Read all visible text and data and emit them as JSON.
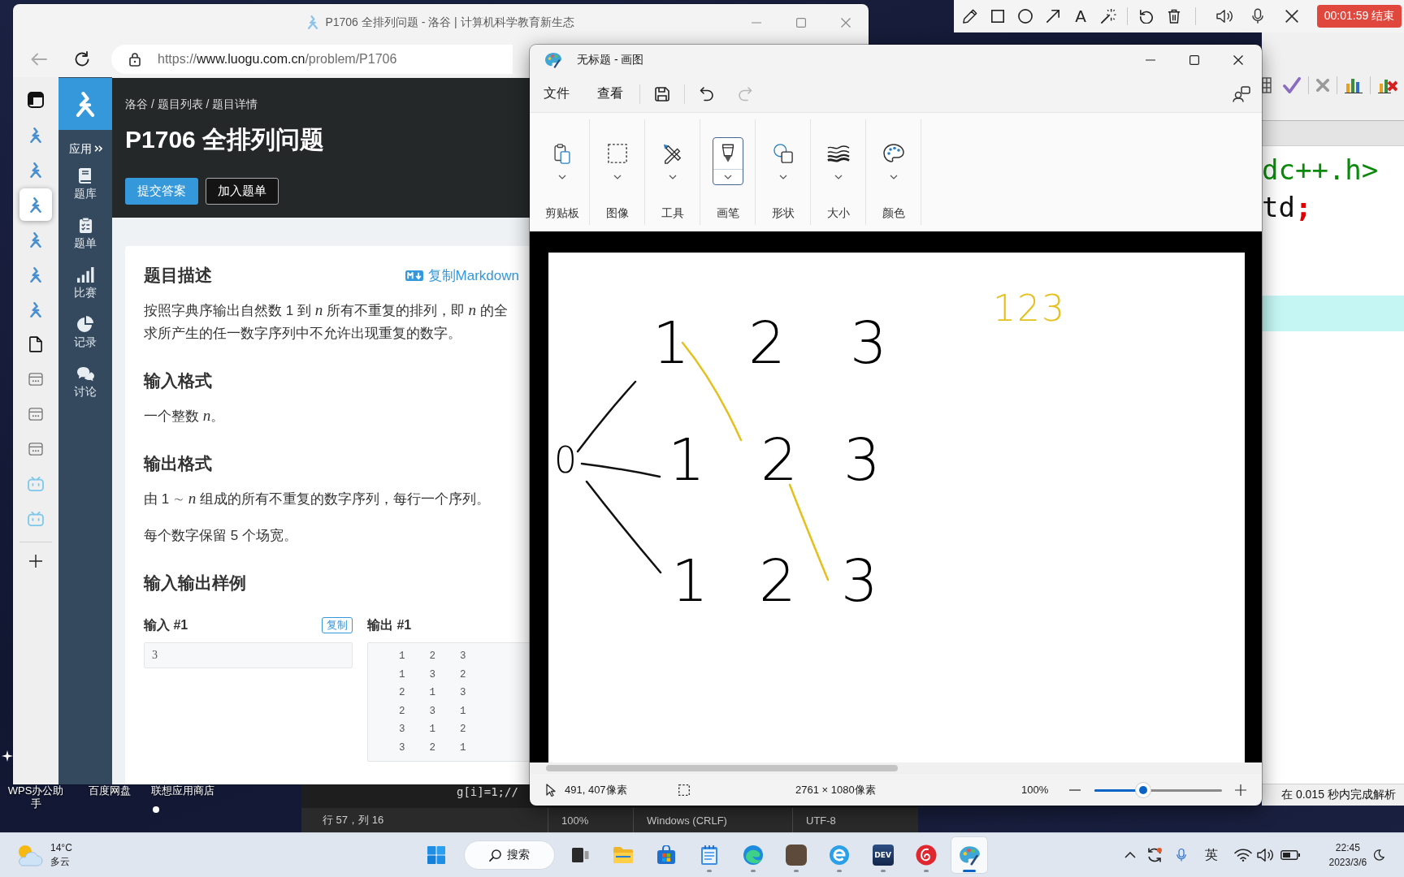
{
  "recorder": {
    "text_tool": "A",
    "timer_button": "00:01:59 结束"
  },
  "devcpp": {
    "code_lines": [
      {
        "tokens": [
          {
            "text": "dc++.h>",
            "kind": "preprocessor"
          }
        ]
      },
      {
        "tokens": [
          {
            "text": "td",
            "kind": "plain"
          },
          {
            "text": ";",
            "kind": "symbol"
          }
        ]
      }
    ],
    "status": "在 0.015 秒内完成解析"
  },
  "notepad": {
    "code_line": "g[i]=1;//",
    "status": [
      "行 57，列 16",
      "100%",
      "Windows (CRLF)",
      "UTF-8"
    ]
  },
  "desktop_icons": [
    "WPS办公助手",
    "百度网盘",
    "联想应用商店"
  ],
  "browser": {
    "title": "P1706 全排列问题 - 洛谷 | 计算机科学教育新生态",
    "url": "https://www.luogu.com.cn/problem/P1706",
    "tabs": [
      {
        "kind": "logo",
        "selected": false
      },
      {
        "kind": "logo",
        "selected": false
      },
      {
        "kind": "logo",
        "selected": true
      },
      {
        "kind": "logo",
        "selected": false
      },
      {
        "kind": "logo",
        "selected": false
      },
      {
        "kind": "logo",
        "selected": false
      },
      {
        "kind": "document",
        "selected": false
      },
      {
        "kind": "window",
        "selected": false
      },
      {
        "kind": "window",
        "selected": false
      },
      {
        "kind": "window",
        "selected": false
      },
      {
        "kind": "tv",
        "selected": false
      },
      {
        "kind": "tv",
        "selected": false
      }
    ],
    "site_nav": {
      "apps_label": "应用",
      "items": [
        {
          "label": "题库",
          "kind": "book"
        },
        {
          "label": "题单",
          "kind": "list"
        },
        {
          "label": "比赛",
          "kind": "bars"
        },
        {
          "label": "记录",
          "kind": "pie"
        },
        {
          "label": "讨论",
          "kind": "chat"
        }
      ]
    },
    "header": {
      "breadcrumb": "洛谷 / 题目列表 / 题目详情",
      "title": "P1706 全排列问题",
      "buttons": [
        {
          "label": "提交答案",
          "kind": "primary"
        },
        {
          "label": "加入题单",
          "kind": "secondary"
        }
      ]
    },
    "problem": {
      "sections": [
        {
          "heading": "题目描述",
          "link": "复制Markdown",
          "paragraphs": [
            [
              "按照字典序输出自然数 1 到 *n* 所有不重复的排列，即 *n* 的全",
              "求所产生的任一数字序列中不允许出现重复的数字。"
            ]
          ]
        },
        {
          "heading": "输入格式",
          "paragraphs": [
            [
              "一个整数 *n*。"
            ]
          ]
        },
        {
          "heading": "输出格式",
          "paragraphs": [
            [
              "由 1 ∼ *n* 组成的所有不重复的数字序列，每行一个序列。"
            ],
            [
              "每个数字保留 5 个场宽。"
            ]
          ]
        },
        {
          "heading": "输入输出样例"
        }
      ],
      "samples": {
        "input": {
          "label": "输入 #1",
          "copy": "复制",
          "value": "3"
        },
        "output": {
          "label": "输出 #1",
          "rows": [
            "1    2    3",
            "1    3    2",
            "2    1    3",
            "2    3    1",
            "3    1    2",
            "3    2    1"
          ]
        }
      }
    }
  },
  "paint": {
    "title": "无标题 - 画图",
    "menu": [
      "文件",
      "查看"
    ],
    "quick": [
      {
        "kind": "save",
        "disabled": false
      },
      {
        "kind": "undo",
        "disabled": false
      },
      {
        "kind": "redo",
        "disabled": true
      }
    ],
    "ribbon": [
      {
        "label": "剪贴板",
        "kind": "clipboard",
        "selected": false
      },
      {
        "label": "图像",
        "kind": "image",
        "selected": false
      },
      {
        "label": "工具",
        "kind": "tools",
        "selected": false
      },
      {
        "label": "画笔",
        "kind": "brushes",
        "selected": true
      },
      {
        "label": "形状",
        "kind": "shapes",
        "selected": false
      },
      {
        "label": "大小",
        "kind": "size",
        "selected": false
      },
      {
        "label": "颜色",
        "kind": "colors",
        "selected": false
      }
    ],
    "canvas": {
      "root": "0",
      "rows": [
        [
          "1",
          "2",
          "3"
        ],
        [
          "1",
          "2",
          "3"
        ],
        [
          "1",
          "2",
          "3"
        ]
      ],
      "note": "123"
    },
    "status": {
      "cursor": "491, 407像素",
      "image_size": "2761 × 1080像素",
      "zoom": "100%",
      "zoom_slider": {
        "level": 0.38
      }
    }
  },
  "taskbar": {
    "weather": {
      "temperature": "14°C",
      "condition": "多云"
    },
    "search_label": "搜索",
    "apps": [
      {
        "kind": "taskview",
        "running": false,
        "selected": false
      },
      {
        "kind": "explorer",
        "running": false,
        "selected": false
      },
      {
        "kind": "store",
        "running": false,
        "selected": false
      },
      {
        "kind": "notepad",
        "running": true,
        "selected": false
      },
      {
        "kind": "edge",
        "running": true,
        "selected": false
      },
      {
        "kind": "photo",
        "running": true,
        "selected": false
      },
      {
        "kind": "ie",
        "running": true,
        "selected": false
      },
      {
        "kind": "devcpp",
        "label": "DEV",
        "running": true,
        "selected": false
      },
      {
        "kind": "music",
        "running": true,
        "selected": false
      },
      {
        "kind": "paint",
        "running": true,
        "selected": true
      }
    ],
    "ime": "英",
    "clock": {
      "time": "22:45",
      "date": "2023/3/6"
    }
  }
}
